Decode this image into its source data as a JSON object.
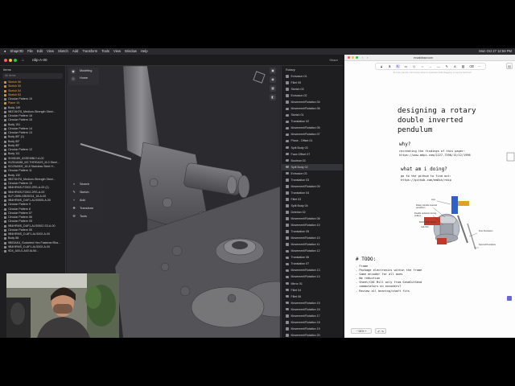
{
  "menubar": {
    "app": "Shapr3D",
    "items": [
      "File",
      "Edit",
      "View",
      "Sketch",
      "Add",
      "Transform",
      "Tools",
      "View",
      "Window",
      "Help"
    ],
    "clock": "Mon Oct 27 12:59 PM"
  },
  "shapr": {
    "title": "rdip-A-00",
    "share_label": "Share",
    "tree_header": "Items",
    "tree_search_placeholder": "All Items",
    "tree_items": [
      {
        "label": "Sketch 56",
        "hl": true
      },
      {
        "label": "Sketch 55",
        "hl": true
      },
      {
        "label": "Sketch 54",
        "hl": true
      },
      {
        "label": "Sketch 53",
        "hl": true
      },
      {
        "label": "Circular Pattern 19",
        "hl": false
      },
      {
        "label": "Plane 19",
        "hl": true
      },
      {
        "label": "Body 149",
        "hl": false
      },
      {
        "label": "9B374KF8_Medium-Strength Steel...",
        "hl": false
      },
      {
        "label": "Circular Pattern 16",
        "hl": false
      },
      {
        "label": "Circular Pattern 15",
        "hl": false
      },
      {
        "label": "Body 151",
        "hl": false
      },
      {
        "label": "Circular Pattern 14",
        "hl": false
      },
      {
        "label": "Circular Pattern 13",
        "hl": false
      },
      {
        "label": "Body 85° (1)",
        "hl": false
      },
      {
        "label": "Body 85°",
        "hl": false
      },
      {
        "label": "Body 85°",
        "hl": false
      },
      {
        "label": "Circular Pattern 12",
        "hl": false
      },
      {
        "label": "Body 111",
        "hl": false
      },
      {
        "label": "SH08189_ASSEMBLY-A-00",
        "hl": false
      },
      {
        "label": "91251A088_M3 THREADS_M-3 Steel...",
        "hl": false
      },
      {
        "label": "92125A909_18-8 Stainless Steel H...",
        "hl": false
      },
      {
        "label": "Circular Pattern 11",
        "hl": false
      },
      {
        "label": "Body 132",
        "hl": false
      },
      {
        "label": "9B374KF8_Medium-Strength Steel...",
        "hl": false
      },
      {
        "label": "Circular Pattern 10",
        "hl": false
      },
      {
        "label": "9B4HRMS-F2502-2RS-A-00 (1)",
        "hl": false
      },
      {
        "label": "9B4HRMS-F2502-2RS-A-00",
        "hl": false
      },
      {
        "label": "SLP-2896-GB09214_18-A-00",
        "hl": false
      },
      {
        "label": "9B4HRMS_DAF1-ALS0505-A-00",
        "hl": false
      },
      {
        "label": "Circular Pattern 9",
        "hl": false
      },
      {
        "label": "Circular Pattern 8",
        "hl": false
      },
      {
        "label": "Circular Pattern 57",
        "hl": false
      },
      {
        "label": "Circular Pattern 56",
        "hl": false
      },
      {
        "label": "Circular Pattern 05",
        "hl": false
      },
      {
        "label": "9B4HRMS_DAF1-ALS0502-S3-A-00",
        "hl": false
      },
      {
        "label": "Circular Pattern 55",
        "hl": false
      },
      {
        "label": "9B4HRMS_D-AF1-ALS002-A-00",
        "hl": false
      },
      {
        "label": "Body 88",
        "hl": false
      },
      {
        "label": "9B53AK4_Socketed Hex Fastener/Sha...",
        "hl": false
      },
      {
        "label": "9B4HRMS_D-AF1-ALS002-A-00",
        "hl": false
      },
      {
        "label": "9D4_A00-0-A00 ALIM...",
        "hl": false
      }
    ],
    "viewport_panel": {
      "modeling": "Modeling",
      "home": "Home"
    },
    "viewport_tools": [
      "Search",
      "Sketch",
      "Add",
      "Transform",
      "Tools"
    ],
    "right_tools": [
      "view-cube-icon",
      "eye-icon",
      "grid-icon",
      "section-icon"
    ],
    "ops_header": "History",
    "ops_tab": "Rotary",
    "operations": [
      "Extrusion 01",
      "Fillet 05",
      "Sketch 03",
      "Extrusion 02",
      "Movement/Rotation 04",
      "Movement/Rotation 06",
      "Sketch 01",
      "Translation 02",
      "Movement/Rotation 05",
      "Movement/Rotation 07",
      "Plane - Offset 01",
      "Split Body 03",
      "Face-Offset 07",
      "Boolean 03",
      "Split Body 02",
      "Extrusion 03",
      "Translation 03",
      "Movement/Rotation 09",
      "Translation 04",
      "Fillet 03",
      "Split Body 04",
      "Deletion 02",
      "Movement/Rotation 08",
      "Movement/Rotation 10",
      "Translation 05",
      "Movement/Rotation 10",
      "Movement/Rotation 11",
      "Movement/Rotation 12",
      "Translation 06",
      "Translation 07",
      "Movement/Rotation 13",
      "Movement/Rotation 14",
      "Mirror 01",
      "Fillet 04",
      "Fillet 06",
      "Movement/Rotation 15",
      "Movement/Rotation 16",
      "Movement/Rotation 17",
      "Movement/Rotation 18",
      "Movement/Rotation 19",
      "Movement/Rotation 20"
    ],
    "selected_op": 14
  },
  "browser": {
    "url": "excalidraw.com",
    "hint": "To move canvas, hold mouse wheel or spacebar while dragging, or use the hand tool",
    "tools": [
      "lock-icon",
      "hand-icon",
      "cursor-icon",
      "rectangle-icon",
      "diamond-icon",
      "ellipse-icon",
      "arrow-icon",
      "line-icon",
      "pencil-icon",
      "text-icon",
      "image-icon",
      "eraser-icon",
      "more-icon"
    ],
    "doc": {
      "title": "designing a rotary double inverted pendulum",
      "why_heading": "why?",
      "why_text_1": "recreating the findings of this paper:",
      "why_text_2": "https://www.mdpi.com/2227-7390/13/12/1996",
      "what_heading": "what am i doing?",
      "what_text_1": "go to the github to find out:",
      "what_text_2": "https://github.com/em8sh/rdip",
      "todo_heading": "# TODO:",
      "todo_items": [
        "- Frame",
        "- Package electronics within the frame",
        "- Same encoder for all axes",
        "- No reduction",
        "- Sheet/CNC Mill only from SendCutSend",
        "- commutators on encoders?",
        "- Review all bearing/shaft fits"
      ],
      "diagram_labels": {
        "axis": "Axis",
        "rotary": "Rotary double inverted pendulum",
        "timing": "Double reduction timing pulleys",
        "bldc": "BLDC (with board)",
        "lab": "Lab-Volt",
        "first": "First Pendulum",
        "second": "Second Pendulum"
      }
    },
    "zoom": "94%"
  }
}
